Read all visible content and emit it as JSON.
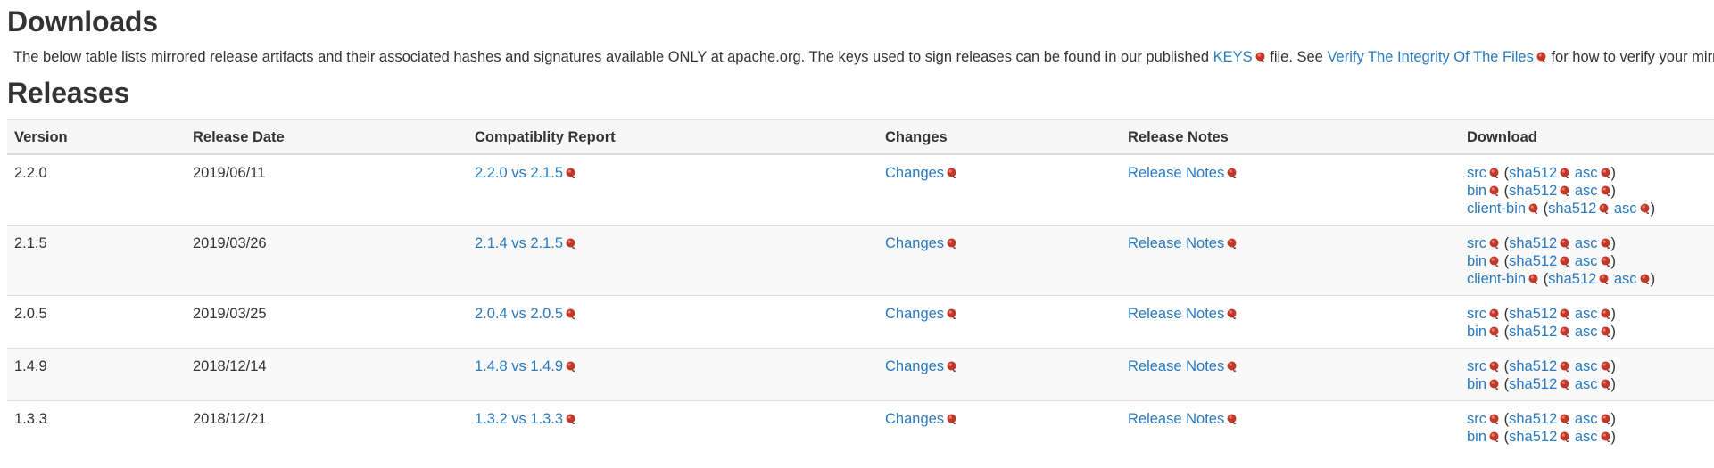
{
  "heading": "Downloads",
  "intro": {
    "before_keys": "The below table lists mirrored release artifacts and their associated hashes and signatures available ONLY at apache.org. The keys used to sign releases can be found in our published ",
    "keys_link": "KEYS",
    "mid_text": " file. See ",
    "verify_link": "Verify The Integrity Of The Files",
    "after_verify": " for how to verify your mirrored d"
  },
  "releases_heading": "Releases",
  "table": {
    "headers": [
      "Version",
      "Release Date",
      "Compatiblity Report",
      "Changes",
      "Release Notes",
      "Download"
    ],
    "rows": [
      {
        "version": "2.2.0",
        "date": "2019/06/11",
        "compat": "2.2.0 vs 2.1.5",
        "changes": "Changes",
        "notes": "Release Notes",
        "downloads": [
          {
            "name": "src",
            "sha": "sha512",
            "asc": "asc"
          },
          {
            "name": "bin",
            "sha": "sha512",
            "asc": "asc"
          },
          {
            "name": "client-bin",
            "sha": "sha512",
            "asc": "asc"
          }
        ]
      },
      {
        "version": "2.1.5",
        "date": "2019/03/26",
        "compat": "2.1.4 vs 2.1.5",
        "changes": "Changes",
        "notes": "Release Notes",
        "downloads": [
          {
            "name": "src",
            "sha": "sha512",
            "asc": "asc"
          },
          {
            "name": "bin",
            "sha": "sha512",
            "asc": "asc"
          },
          {
            "name": "client-bin",
            "sha": "sha512",
            "asc": "asc"
          }
        ]
      },
      {
        "version": "2.0.5",
        "date": "2019/03/25",
        "compat": "2.0.4 vs 2.0.5",
        "changes": "Changes",
        "notes": "Release Notes",
        "downloads": [
          {
            "name": "src",
            "sha": "sha512",
            "asc": "asc"
          },
          {
            "name": "bin",
            "sha": "sha512",
            "asc": "asc"
          }
        ]
      },
      {
        "version": "1.4.9",
        "date": "2018/12/14",
        "compat": "1.4.8 vs 1.4.9",
        "changes": "Changes",
        "notes": "Release Notes",
        "downloads": [
          {
            "name": "src",
            "sha": "sha512",
            "asc": "asc"
          },
          {
            "name": "bin",
            "sha": "sha512",
            "asc": "asc"
          }
        ]
      },
      {
        "version": "1.3.3",
        "date": "2018/12/21",
        "compat": "1.3.2 vs 1.3.3",
        "changes": "Changes",
        "notes": "Release Notes",
        "downloads": [
          {
            "name": "src",
            "sha": "sha512",
            "asc": "asc"
          },
          {
            "name": "bin",
            "sha": "sha512",
            "asc": "asc"
          }
        ]
      }
    ]
  },
  "colors": {
    "link": "#2a7ac0",
    "text": "#333333",
    "row_stripe": "#f9f9f9",
    "border": "#dddddd",
    "external_icon": "#c0392b"
  },
  "icons": {
    "external_link": "feather-external-link-icon"
  }
}
